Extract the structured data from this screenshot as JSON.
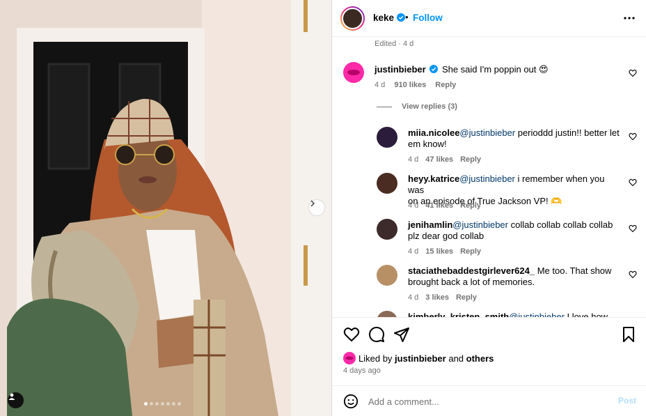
{
  "post": {
    "author": "keke",
    "follow_label": "Follow",
    "dot_separator": "•",
    "edited_label": "Edited · 4 d",
    "carousel_count": 7,
    "carousel_active": 0
  },
  "comments": [
    {
      "user": "justinbieber",
      "verified": true,
      "text": "She said I'm poppin out 😍",
      "time": "4 d",
      "likes": "910 likes",
      "reply_label": "Reply",
      "avatar_color": "#ff2aa8"
    }
  ],
  "view_replies_label": "View replies (3)",
  "replies": [
    {
      "user": "miia.nicolee",
      "mention": "@justinbieber",
      "text_line1": " perioddd justin!! better let",
      "text_line2": "em know!",
      "time": "4 d",
      "likes": "47 likes",
      "reply_label": "Reply",
      "avatar_color": "#2a1c3a"
    },
    {
      "user": "heyy.katrice",
      "mention": "@justinbieber",
      "text_line1": " i remember when you was",
      "text_line2": "on an episode of True Jackson VP! 🫶",
      "time": "4 d",
      "likes": "41 likes",
      "reply_label": "Reply",
      "avatar_color": "#4a2c22"
    },
    {
      "user": "jenihamlin",
      "mention": "@justinbieber",
      "text_line1": " collab collab collab collab",
      "text_line2": "plz dear god collab",
      "time": "4 d",
      "likes": "15 likes",
      "reply_label": "Reply",
      "avatar_color": "#3d2a2a"
    },
    {
      "user": "staciathebaddestgirlever624_",
      "mention": "",
      "text_line1": " Me too. That show",
      "text_line2": "brought back a lot of memories.",
      "time": "4 d",
      "likes": "3 likes",
      "reply_label": "Reply",
      "avatar_color": "#b89066"
    },
    {
      "user": "kimberly_kristen_smith",
      "mention": "@justinbieber",
      "text_line1": " I love how you",
      "text_line2": "",
      "time": "",
      "likes": "",
      "reply_label": "",
      "avatar_color": "#8a6a55"
    }
  ],
  "liked_by": {
    "prefix": "Liked by ",
    "user": "justinbieber",
    "middle": " and ",
    "others": "others"
  },
  "time_ago": "4 days ago",
  "add_comment": {
    "placeholder": "Add a comment...",
    "post_label": "Post"
  },
  "icons": [
    "heart-icon",
    "comment-icon",
    "share-icon",
    "bookmark-icon",
    "emoji-icon",
    "more-icon",
    "verified-icon",
    "chevron-right-icon",
    "user-tag-icon"
  ],
  "colors": {
    "accent": "#0095f6",
    "verified": "#0095f6",
    "muted": "#737373",
    "mention": "#00376b",
    "post_disabled": "#b2dffc"
  }
}
